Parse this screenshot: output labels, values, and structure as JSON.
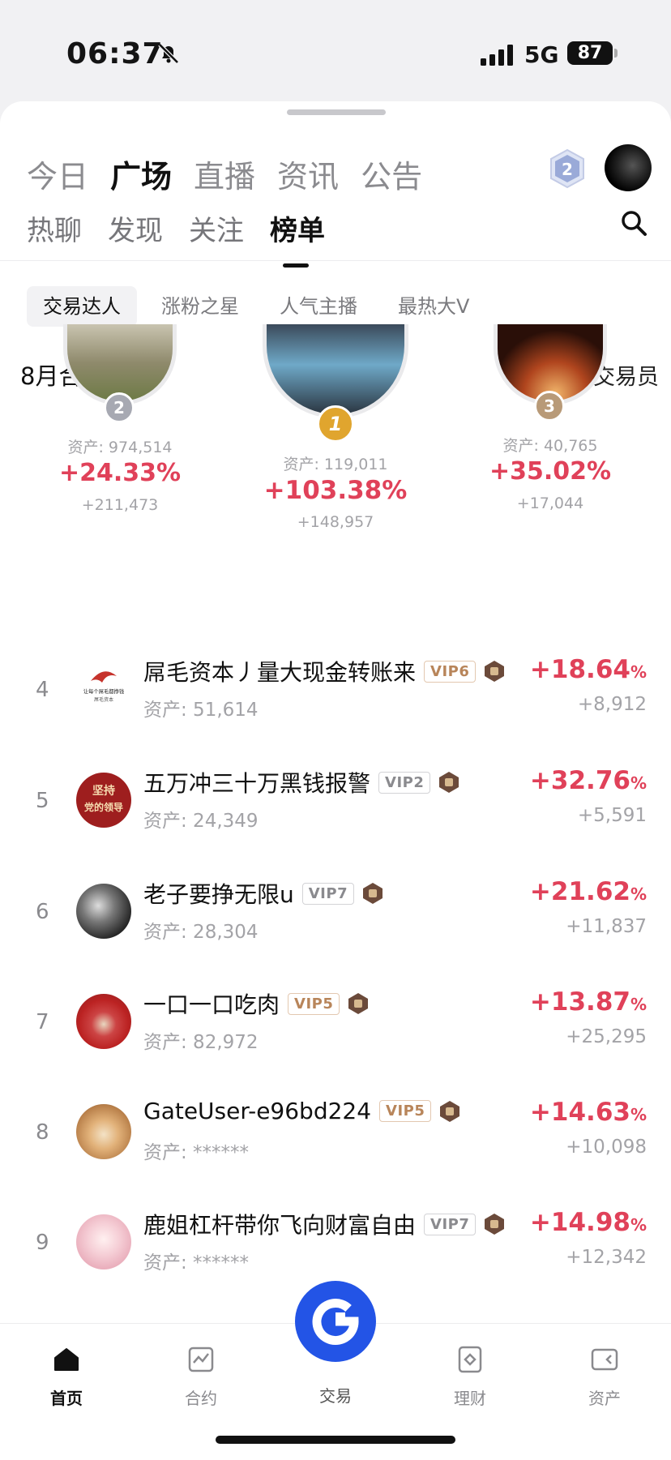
{
  "status": {
    "time": "06:37",
    "network": "5G",
    "battery": "87"
  },
  "main_tabs": [
    "今日",
    "广场",
    "直播",
    "资讯",
    "公告"
  ],
  "sub_tabs": [
    "热聊",
    "发现",
    "关注",
    "榜单"
  ],
  "level_badge": "2",
  "filter_pills": [
    "交易达人",
    "涨粉之星",
    "人气主播",
    "最热大V"
  ],
  "board": {
    "title": "8月合约榜单",
    "checkbox_label": "带单交易员"
  },
  "podium": [
    {
      "rank": "2",
      "asset": "资产: 974,514",
      "percent": "+24.33%",
      "profit": "+211,473"
    },
    {
      "rank": "1",
      "asset": "资产: 119,011",
      "percent": "+103.38%",
      "profit": "+148,957"
    },
    {
      "rank": "3",
      "asset": "资产: 40,765",
      "percent": "+35.02%",
      "profit": "+17,044"
    }
  ],
  "rows": [
    {
      "rank": "4",
      "name": "屌毛资本丿量大现金转账来",
      "vip": "VIP6",
      "asset": "资产: 51,614",
      "percent": "+18.64",
      "pct_sign": "%",
      "profit": "+8,912"
    },
    {
      "rank": "5",
      "name": "五万冲三十万黑钱报警",
      "vip": "VIP2",
      "asset": "资产: 24,349",
      "percent": "+32.76",
      "pct_sign": "%",
      "profit": "+5,591"
    },
    {
      "rank": "6",
      "name": "老子要挣无限u",
      "vip": "VIP7",
      "asset": "资产: 28,304",
      "percent": "+21.62",
      "pct_sign": "%",
      "profit": "+11,837"
    },
    {
      "rank": "7",
      "name": "一口一口吃肉",
      "vip": "VIP5",
      "asset": "资产: 82,972",
      "percent": "+13.87",
      "pct_sign": "%",
      "profit": "+25,295"
    },
    {
      "rank": "8",
      "name": "GateUser-e96bd224",
      "vip": "VIP5",
      "asset": "资产: ******",
      "percent": "+14.63",
      "pct_sign": "%",
      "profit": "+10,098"
    },
    {
      "rank": "9",
      "name": "鹿姐杠杆带你飞向财富自由",
      "vip": "VIP7",
      "asset": "资产: ******",
      "percent": "+14.98",
      "pct_sign": "%",
      "profit": "+12,342"
    }
  ],
  "avatar_texts": {
    "row4": "让每个屌毛都挣钱",
    "row4_sub": "屌毛资本",
    "row5_line1": "坚持",
    "row5_line2": "党的领导"
  },
  "nav": {
    "home": "首页",
    "futures": "合约",
    "trade": "交易",
    "wealth": "理财",
    "assets": "资产"
  },
  "colors": {
    "accent_red": "#e04159",
    "brand_blue": "#2354e6",
    "gold": "#e0a52e"
  }
}
